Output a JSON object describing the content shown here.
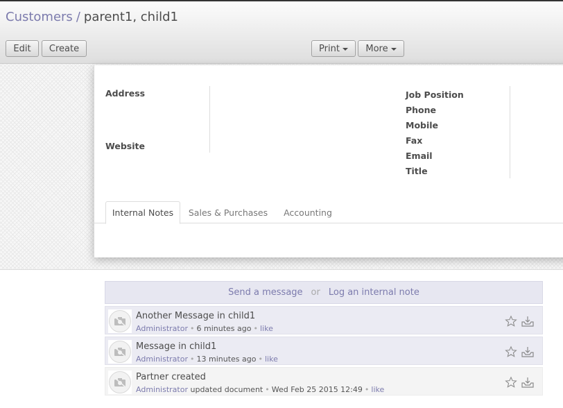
{
  "breadcrumb": {
    "parent": "Customers",
    "separator": "/",
    "current": "parent1, child1"
  },
  "toolbar": {
    "edit_label": "Edit",
    "create_label": "Create",
    "print_label": "Print",
    "more_label": "More"
  },
  "form": {
    "left_labels": {
      "address": "Address",
      "website": "Website"
    },
    "right_labels": {
      "job_position": "Job Position",
      "phone": "Phone",
      "mobile": "Mobile",
      "fax": "Fax",
      "email": "Email",
      "title": "Title"
    },
    "tabs": [
      {
        "label": "Internal Notes",
        "active": true
      },
      {
        "label": "Sales & Purchases",
        "active": false
      },
      {
        "label": "Accounting",
        "active": false
      }
    ]
  },
  "chatter": {
    "send_message": "Send a message",
    "or": "or",
    "log_note": "Log an internal note",
    "messages": [
      {
        "body": "Another Message in child1",
        "author": "Administrator",
        "action": "",
        "time": "6 minutes ago",
        "like": "like"
      },
      {
        "body": "Message in child1",
        "author": "Administrator",
        "action": "",
        "time": "13 minutes ago",
        "like": "like"
      },
      {
        "body": "Partner created",
        "author": "Administrator",
        "action": "updated document",
        "time": "Wed Feb 25 2015 12:49",
        "like": "like"
      }
    ]
  },
  "colors": {
    "link": "#7c7bad",
    "text": "#4c4c4c",
    "message_bg": "#ebebf3"
  },
  "icons": {
    "avatar": "camera-placeholder-icon",
    "star": "star-icon",
    "inbox": "inbox-icon",
    "caret": "caret-down-icon"
  }
}
